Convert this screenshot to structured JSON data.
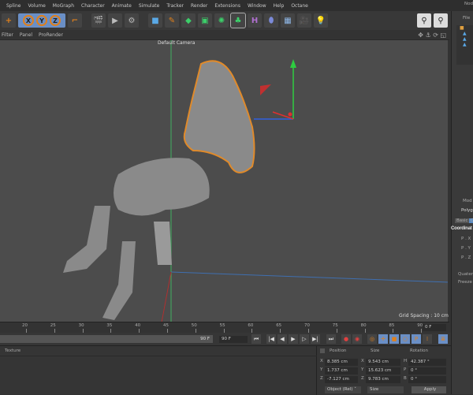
{
  "menu": [
    "Spline",
    "Volume",
    "MoGraph",
    "Character",
    "Animate",
    "Simulate",
    "Tracker",
    "Render",
    "Extensions",
    "Window",
    "Help",
    "Octane"
  ],
  "right_panel": {
    "title": "Nod",
    "file": "File",
    "obj_mode": "Mod",
    "obj_name": "Polyg",
    "tabs": [
      "Basic",
      "C"
    ],
    "section": "Coordinat",
    "params": [
      "P . X",
      "P . Y",
      "P . Z"
    ],
    "extra": [
      "Quater",
      "Freeze"
    ]
  },
  "viewport_menu": [
    "Filter",
    "Panel",
    "ProRender"
  ],
  "viewport": {
    "camera": "Default Camera",
    "grid_spacing": "Grid Spacing : 10 cm"
  },
  "timeline": {
    "ticks": [
      "20",
      "25",
      "30",
      "35",
      "40",
      "45",
      "50",
      "55",
      "60",
      "65",
      "70",
      "75",
      "80",
      "85",
      "90"
    ],
    "current_frame": "0 F",
    "end_frame": "90 F",
    "max_frame": "90 F"
  },
  "material": {
    "label": "Texture"
  },
  "coords": {
    "headers": [
      "Position",
      "Size",
      "Rotation"
    ],
    "rows": [
      {
        "a": "X",
        "p": "8.385 cm",
        "b": "X",
        "s": "9.543 cm",
        "c": "H",
        "r": "42.387 °"
      },
      {
        "a": "Y",
        "p": "1.737 cm",
        "b": "Y",
        "s": "15.623 cm",
        "c": "P",
        "r": "0 °"
      },
      {
        "a": "Z",
        "p": "-7.127 cm",
        "b": "Z",
        "s": "9.783 cm",
        "c": "B",
        "r": "0 °"
      }
    ],
    "mode": "Object (Rel)",
    "size_mode": "Size",
    "apply": "Apply"
  }
}
